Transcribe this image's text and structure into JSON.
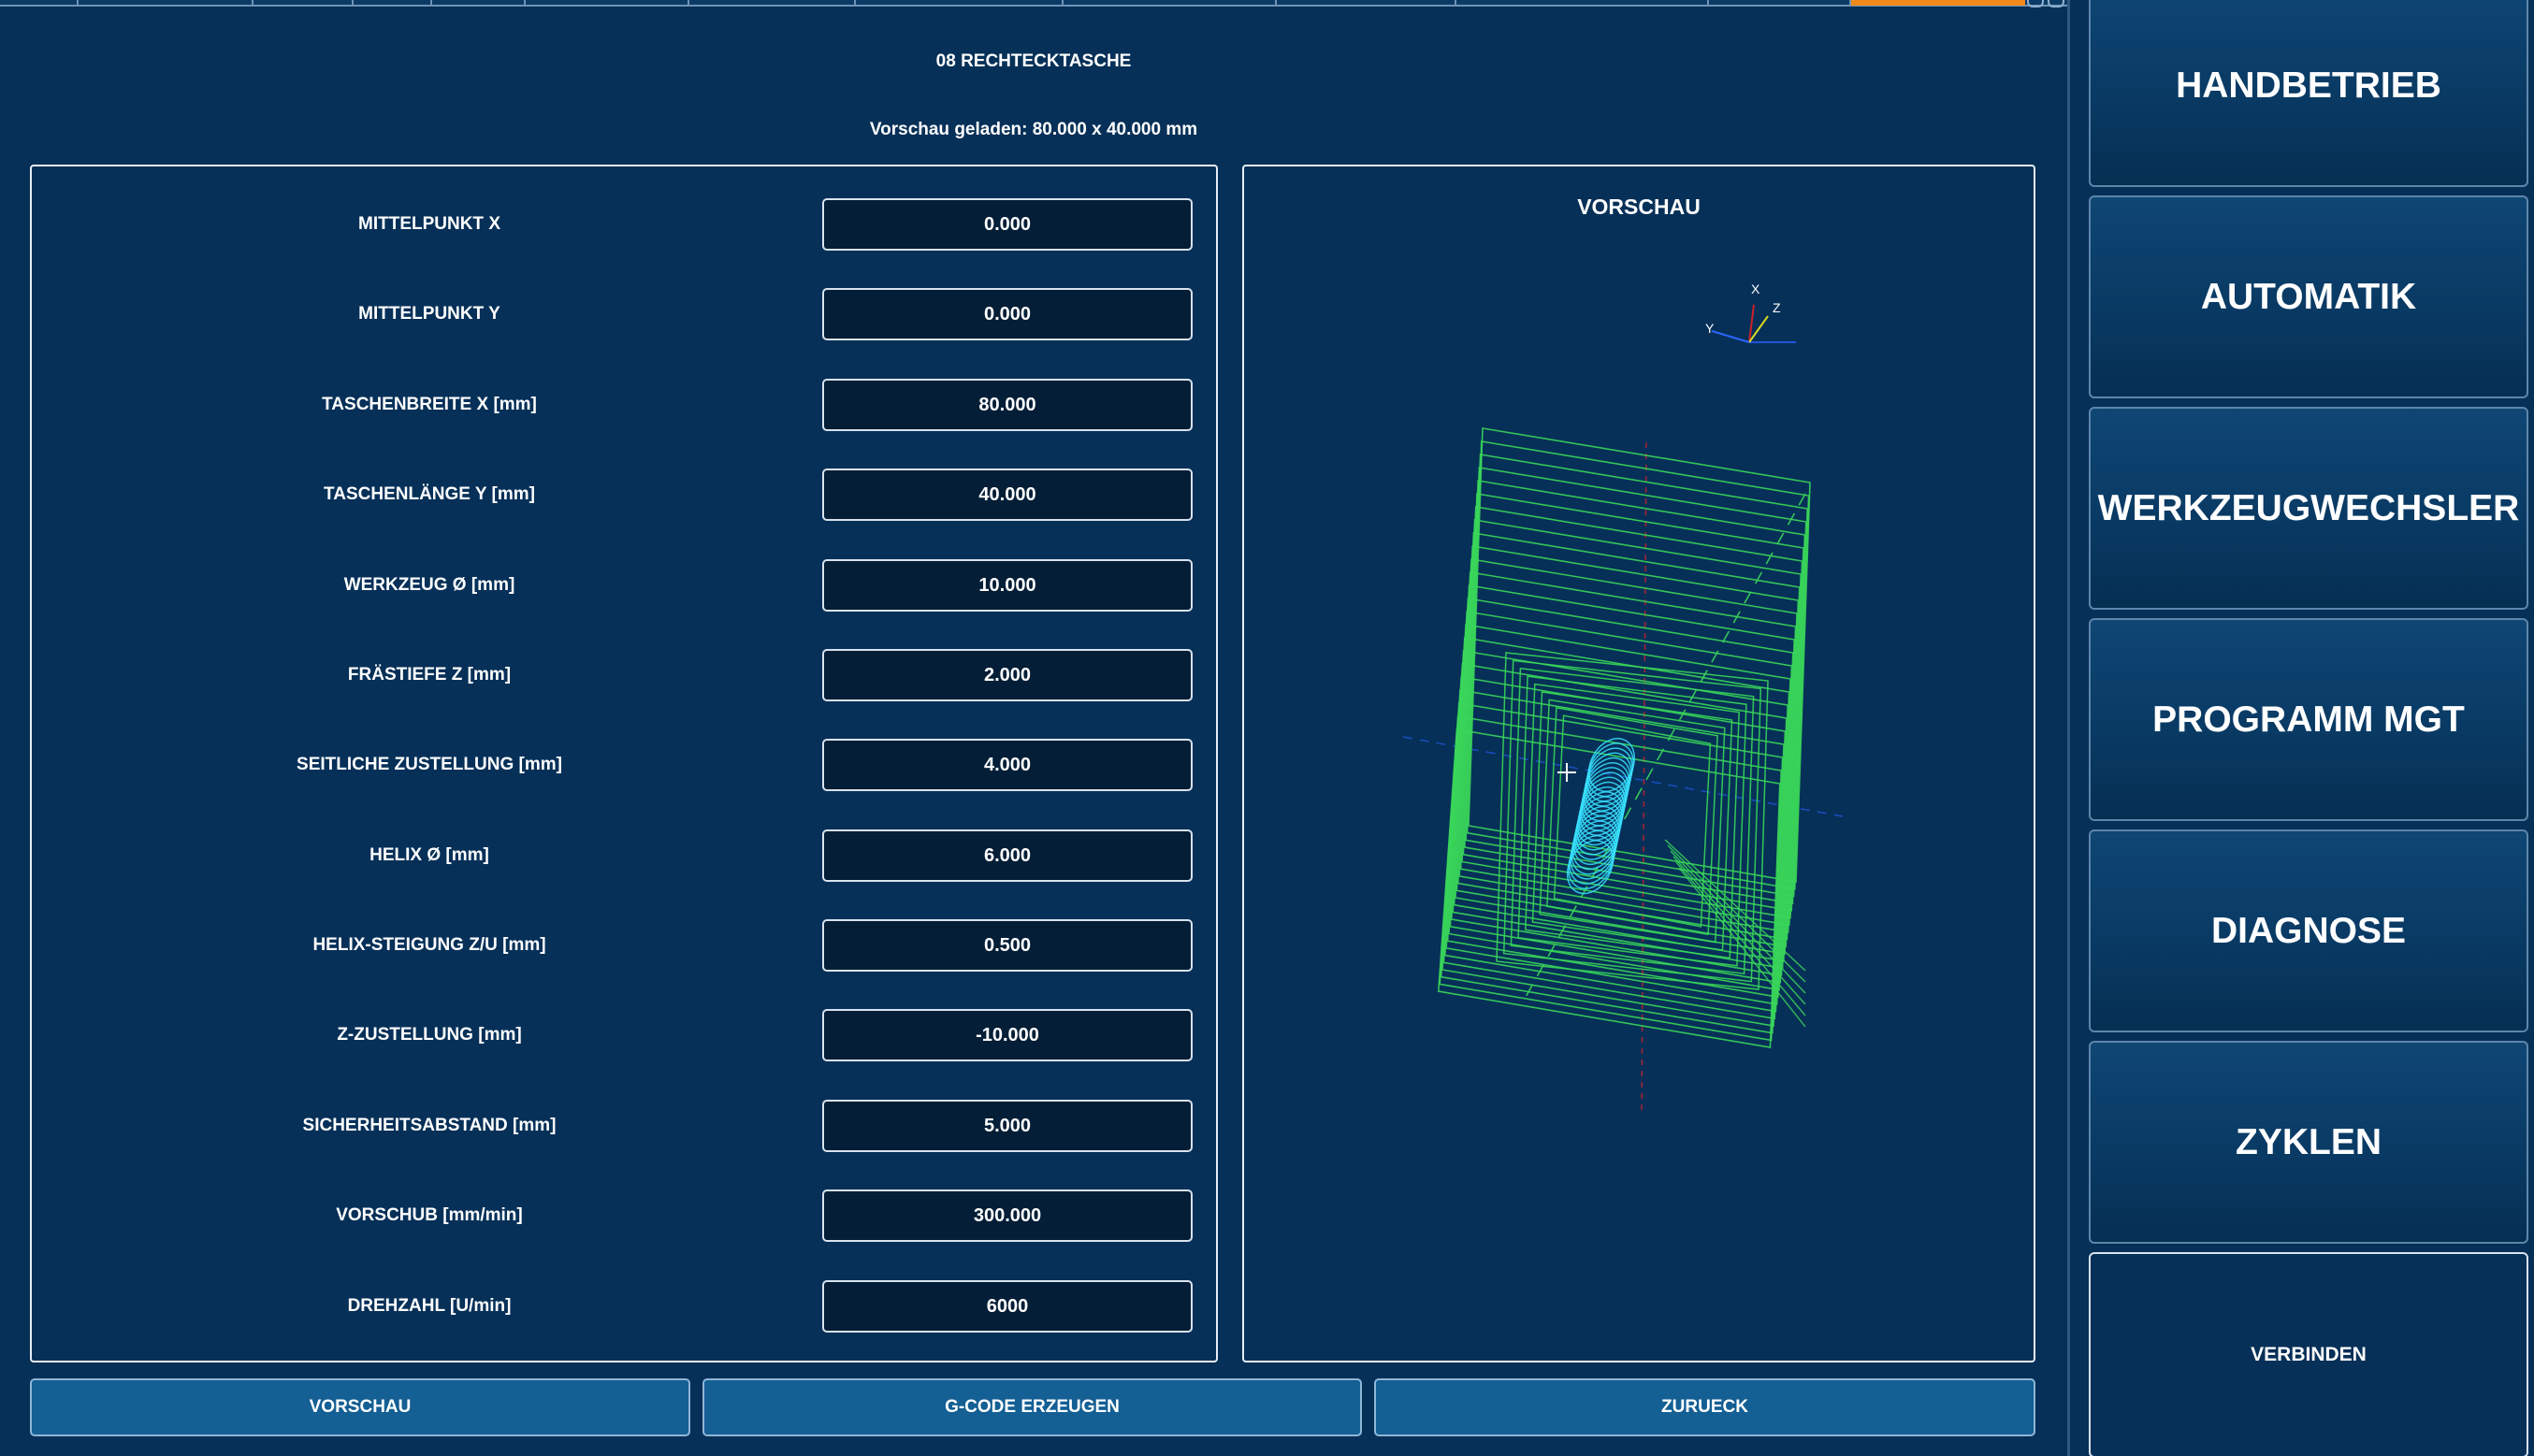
{
  "header": {
    "title": "08 RECHTECKTASCHE",
    "status": "Vorschau geladen: 80.000 x 40.000 mm"
  },
  "params": [
    {
      "label": "MITTELPUNKT X",
      "value": "0.000"
    },
    {
      "label": "MITTELPUNKT Y",
      "value": "0.000"
    },
    {
      "label": "TASCHENBREITE X [mm]",
      "value": "80.000"
    },
    {
      "label": "TASCHENLÄNGE Y [mm]",
      "value": "40.000"
    },
    {
      "label": "WERKZEUG Ø [mm]",
      "value": "10.000"
    },
    {
      "label": "FRÄSTIEFE Z [mm]",
      "value": "2.000"
    },
    {
      "label": "SEITLICHE ZUSTELLUNG [mm]",
      "value": "4.000"
    },
    {
      "label": "HELIX Ø [mm]",
      "value": "6.000"
    },
    {
      "label": "HELIX-STEIGUNG Z/U [mm]",
      "value": "0.500"
    },
    {
      "label": "Z-ZUSTELLUNG [mm]",
      "value": "-10.000"
    },
    {
      "label": "SICHERHEITSABSTAND [mm]",
      "value": "5.000"
    },
    {
      "label": "VORSCHUB [mm/min]",
      "value": "300.000"
    },
    {
      "label": "DREHZAHL [U/min]",
      "value": "6000"
    }
  ],
  "preview": {
    "title": "VORSCHAU",
    "axis_labels": {
      "x": "X",
      "y": "Y",
      "z": "Z"
    },
    "colors": {
      "toolpath": "#3ad65a",
      "helix": "#38e0ff",
      "rapid": "#d0202a",
      "axis": "#1f55d8"
    }
  },
  "buttons": {
    "preview": "VORSCHAU",
    "generate": "G-CODE ERZEUGEN",
    "back": "ZURUECK"
  },
  "sidebar": {
    "items": [
      {
        "label": "HANDBETRIEB"
      },
      {
        "label": "AUTOMATIK"
      },
      {
        "label": "WERKZEUGWECHSLER"
      },
      {
        "label": "PROGRAMM MGT"
      },
      {
        "label": "DIAGNOSE"
      },
      {
        "label": "ZYKLEN"
      },
      {
        "label": "VERBINDEN"
      }
    ]
  },
  "theme": {
    "background": "#063058",
    "accent_tab": "#f08a1a",
    "input_bg": "#031e36",
    "button_bg": "#145f94"
  }
}
